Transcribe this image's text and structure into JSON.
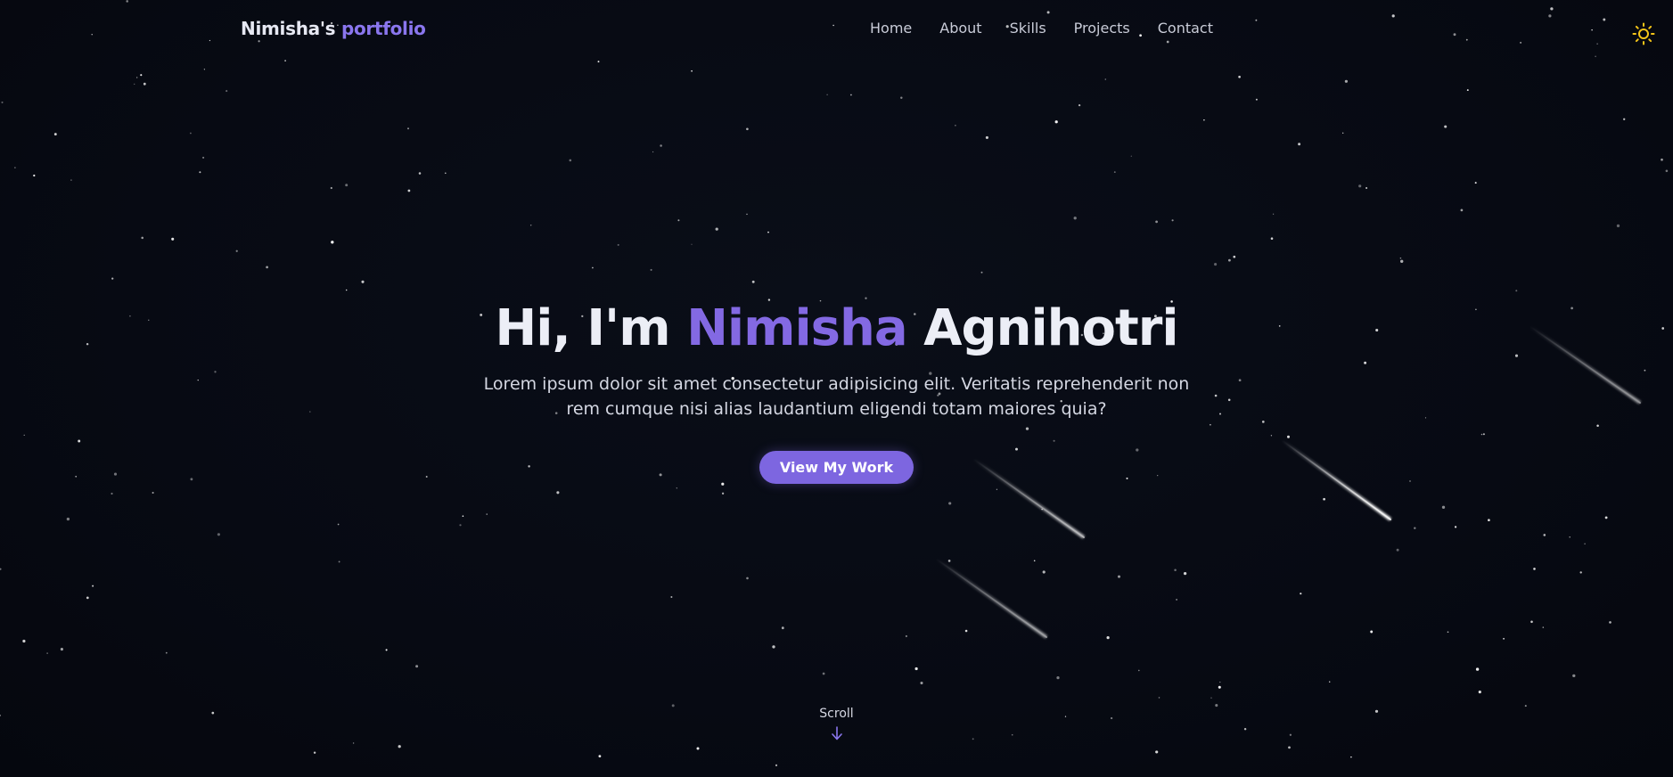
{
  "header": {
    "brand_name": "Nimisha's",
    "brand_accent": "portfolio",
    "nav": [
      {
        "label": "Home"
      },
      {
        "label": "About"
      },
      {
        "label": "Skills"
      },
      {
        "label": "Projects"
      },
      {
        "label": "Contact"
      }
    ],
    "theme_icon": "sun-icon"
  },
  "hero": {
    "greeting": "Hi, I'm",
    "first_name": "Nimisha",
    "last_name": "Agnihotri",
    "subtitle": "Lorem ipsum dolor sit amet consectetur adipisicing elit. Veritatis reprehenderit non rem cumque nisi alias laudantium eligendi totam maiores quia?",
    "cta_label": "View My Work"
  },
  "scroll": {
    "label": "Scroll",
    "icon": "arrow-down-icon"
  },
  "colors": {
    "background": "#070a13",
    "accent": "#8369e3",
    "button": "#7d66e0",
    "sun": "#f5c518"
  }
}
